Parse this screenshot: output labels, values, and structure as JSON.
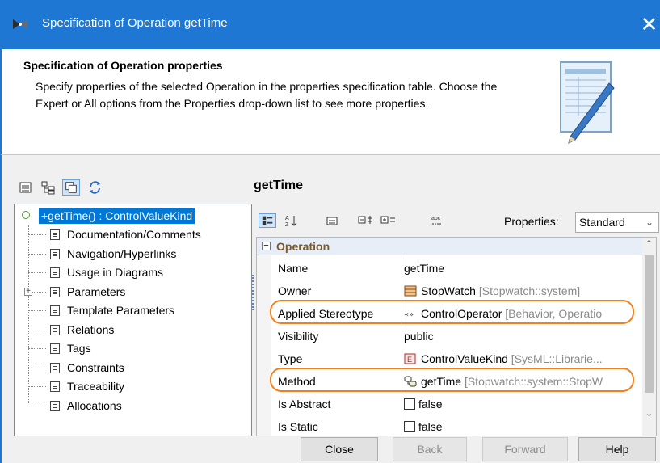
{
  "window": {
    "title": "Specification of Operation getTime",
    "close_glyph": "✕"
  },
  "header": {
    "title": "Specification of Operation properties",
    "description": "Specify properties of the selected Operation in the properties specification table. Choose the Expert or All options from the Properties drop-down list to see more properties."
  },
  "tree": {
    "root": "+getTime() : ControlValueKind",
    "items": [
      {
        "label": "Documentation/Comments",
        "expandable": false
      },
      {
        "label": "Navigation/Hyperlinks",
        "expandable": false
      },
      {
        "label": "Usage in Diagrams",
        "expandable": false
      },
      {
        "label": "Parameters",
        "expandable": true
      },
      {
        "label": "Template Parameters",
        "expandable": false
      },
      {
        "label": "Relations",
        "expandable": false
      },
      {
        "label": "Tags",
        "expandable": false
      },
      {
        "label": "Constraints",
        "expandable": false
      },
      {
        "label": "Traceability",
        "expandable": false
      },
      {
        "label": "Allocations",
        "expandable": false
      }
    ]
  },
  "panel": {
    "title": "getTime",
    "properties_label": "Properties:",
    "properties_value": "Standard"
  },
  "grid": {
    "group": "Operation",
    "rows": [
      {
        "name": "Name",
        "value": "getTime",
        "qualifier": "",
        "icon": "none"
      },
      {
        "name": "Owner",
        "value": "StopWatch",
        "qualifier": " [Stopwatch::system]",
        "icon": "block-icon"
      },
      {
        "name": "Applied Stereotype",
        "value": "ControlOperator",
        "qualifier": " [Behavior, Operatio",
        "icon": "stereotype-icon"
      },
      {
        "name": "Visibility",
        "value": "public",
        "qualifier": "",
        "icon": "none"
      },
      {
        "name": "Type",
        "value": "ControlValueKind",
        "qualifier": " [SysML::Librarie...",
        "icon": "enumeration-icon"
      },
      {
        "name": "Method",
        "value": "getTime",
        "qualifier": " [Stopwatch::system::StopW",
        "icon": "state-machine-icon"
      },
      {
        "name": "Is Abstract",
        "value": "false",
        "qualifier": "",
        "icon": "checkbox"
      },
      {
        "name": "Is Static",
        "value": "false",
        "qualifier": "",
        "icon": "checkbox"
      }
    ]
  },
  "buttons": {
    "close": "Close",
    "back": "Back",
    "forward": "Forward",
    "help": "Help"
  },
  "colors": {
    "titlebar": "#1e77d2",
    "highlight": "#f08020",
    "selection": "#0078d7"
  }
}
